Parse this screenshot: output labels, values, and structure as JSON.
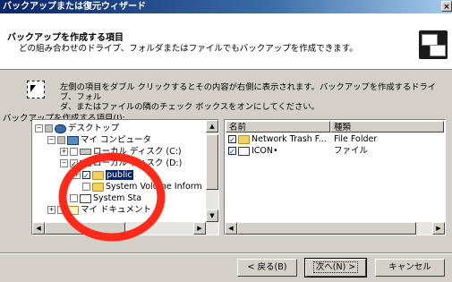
{
  "window": {
    "title": "バックアップまたは復元ウィザード",
    "close_glyph": "×"
  },
  "header": {
    "title": "バックアップを作成する項目",
    "subtitle": "どの組み合わせのドライブ、フォルダまたはファイルでもバックアップを作成できます。",
    "icon": "backup-tape-icon"
  },
  "instruction": {
    "line1": "左側の項目をダブル クリックするとその内容が右側に表示されます。バックアップを作成するドライブ、フォル",
    "line2": "ダ、またはファイルの隣のチェック ボックスをオンにしてください。"
  },
  "tree_label": "バックアップを作成する項目(I):",
  "tree": [
    {
      "label": "デスクトップ",
      "icon": "desktop-icon",
      "expander": "−",
      "checked": false,
      "partial": true
    },
    {
      "label": "マイ コンピュータ",
      "icon": "computer-icon",
      "expander": "−",
      "checked": false,
      "partial": true
    },
    {
      "label": "ローカル ディスク (C:)",
      "icon": "drive-icon",
      "expander": "+",
      "checked": false
    },
    {
      "label": "ローカル ディスク (D:)",
      "icon": "drive-icon",
      "expander": "−",
      "checked": true
    },
    {
      "label": "public",
      "icon": "folder-icon",
      "expander": "+",
      "checked": true,
      "selected": true
    },
    {
      "label": "System Volume Inform",
      "icon": "folder-icon",
      "expander": "",
      "checked": false
    },
    {
      "label": "System Sta",
      "icon": "folder-icon",
      "expander": "",
      "checked": false
    },
    {
      "label": "マイ ドキュメント",
      "icon": "documents-icon",
      "expander": "+",
      "checked": false
    }
  ],
  "list": {
    "columns": [
      "名前",
      "種類"
    ],
    "rows": [
      {
        "name": "Network Trash F...",
        "type": "File Folder",
        "icon": "folder-icon",
        "checked": true
      },
      {
        "name": "ICON•",
        "type": "ファイル",
        "icon": "file-icon",
        "checked": true
      }
    ]
  },
  "buttons": {
    "back": "< 戻る(B)",
    "next": "次へ(N) >",
    "cancel": "キャンセル"
  },
  "colors": {
    "titlebar": "#0a246a",
    "annotation": "#ff2a1a",
    "selection": "#0a246a"
  }
}
